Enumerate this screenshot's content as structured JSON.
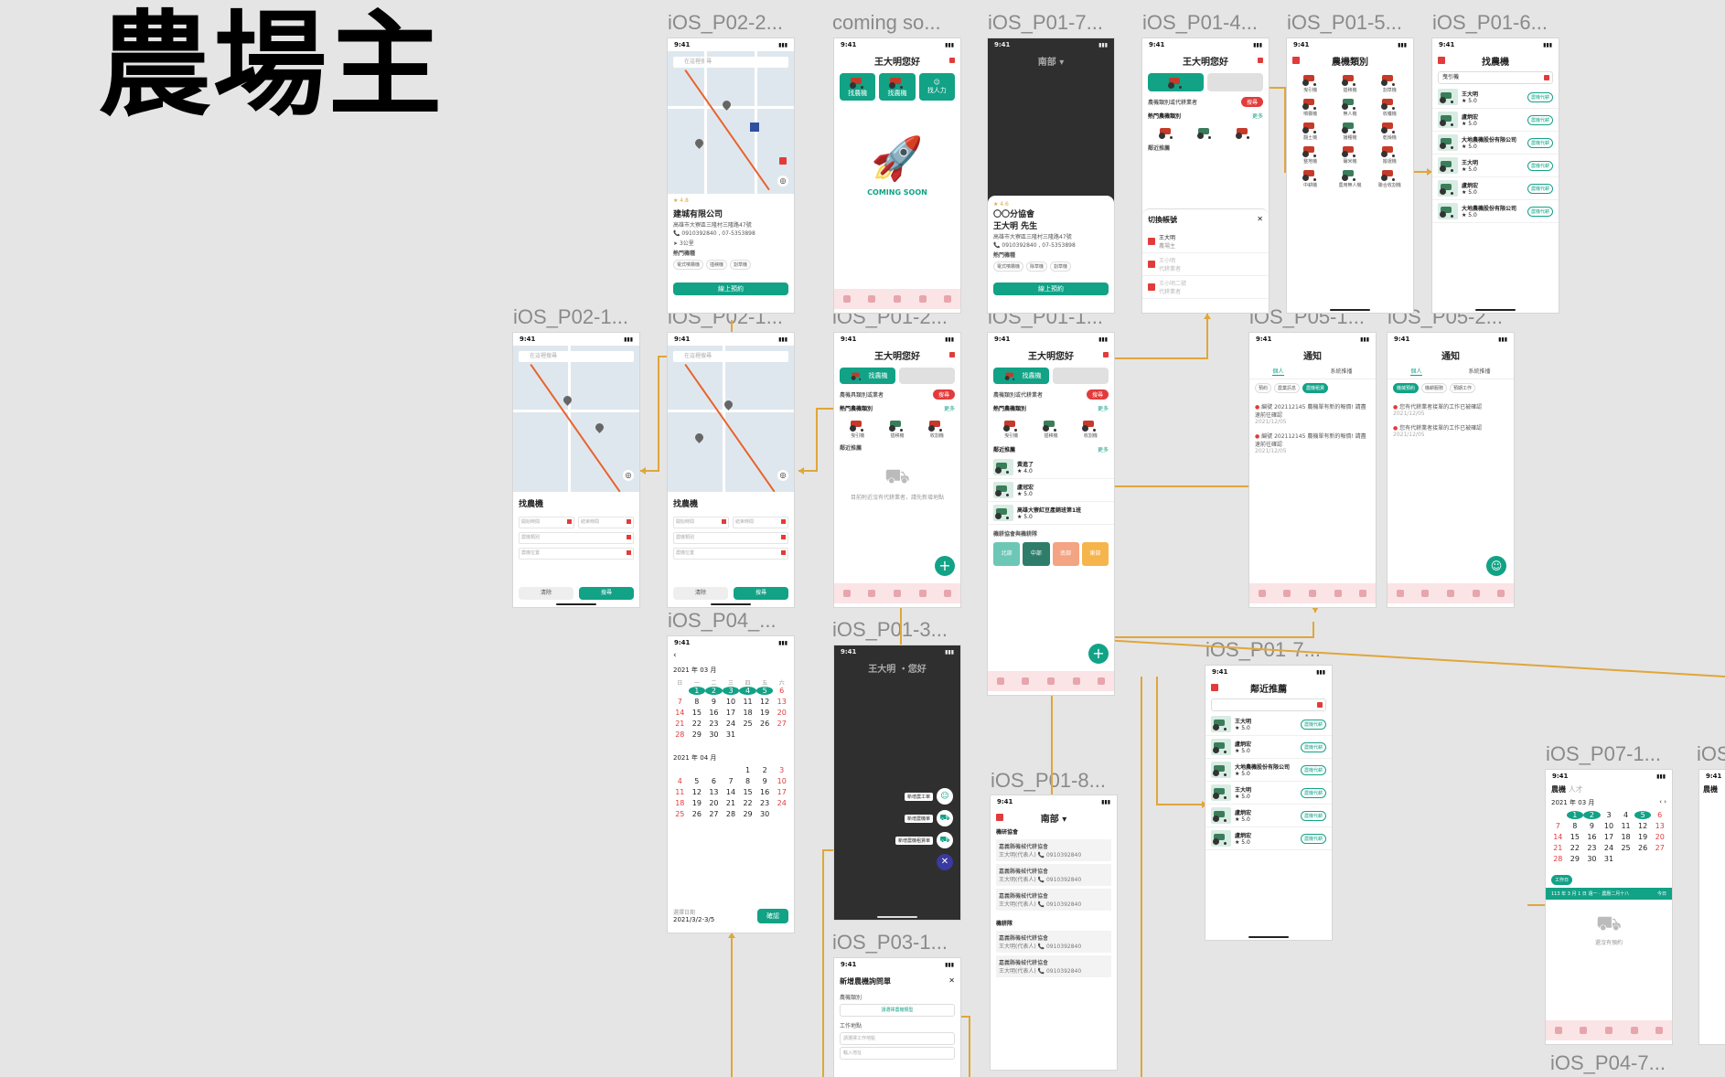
{
  "page_title": "農場主",
  "frames": {
    "p02_2": {
      "label": "iOS_P02-2...",
      "time": "9:41",
      "search_placeholder": "在這裡搜尋",
      "company": "建城有限公司",
      "rating": "4.8",
      "address": "高雄市大寮區三隆村三隆路47號",
      "phone": "0910392840 , 07-5353898",
      "distance": "3公里",
      "section": "熱門機種",
      "tags": [
        "電式噴霧機",
        "插秧機",
        "割草機"
      ],
      "cta": "線上預約"
    },
    "coming": {
      "label": "coming so...",
      "time": "9:41",
      "greeting": "王大明您好",
      "chips": [
        "找農機",
        "找農機",
        "找人力"
      ],
      "coming_text": "COMING SOON"
    },
    "p01_7a": {
      "label": "iOS_P01-7...",
      "time": "9:41",
      "region": "南部 ▾",
      "org": "〇〇分協會",
      "person": "王大明  先生",
      "rating": "4.6",
      "address": "高雄市大寮區三隆村三隆路47號",
      "phone": "0910392840 , 07-5353898",
      "section": "熱門機種",
      "tags": [
        "電式噴霧機",
        "除草機",
        "割草機"
      ],
      "cta": "線上預約"
    },
    "p01_4": {
      "label": "iOS_P01-4...",
      "time": "9:41",
      "greeting": "王大明您好",
      "search": "農機類別或代耕業者",
      "search_btn": "搜尋",
      "hot": "熱門農機類別",
      "more": "更多",
      "nearby": "鄰近推薦",
      "switch_title": "切換帳號",
      "accounts": [
        {
          "name": "王大明",
          "role": "農場主"
        },
        {
          "name": "王小明",
          "role": "代耕業者"
        },
        {
          "name": "王小明二號",
          "role": "代耕業者"
        }
      ]
    },
    "p01_5": {
      "label": "iOS_P01-5...",
      "time": "9:41",
      "title": "農機類別",
      "items": [
        "曳引機",
        "插秧機",
        "割草機",
        "噴霧機",
        "無人機",
        "收穫機",
        "翻土機",
        "播種機",
        "乾燥機",
        "整地機",
        "碾米機",
        "搬運機",
        "中耕機",
        "農用無人機",
        "聯合收割機"
      ]
    },
    "p01_6": {
      "label": "iOS_P01-6...",
      "time": "9:41",
      "title": "找農機",
      "search_value": "曳引機",
      "results": [
        {
          "name": "王大明",
          "rating": "5.0"
        },
        {
          "name": "盧炳宏",
          "rating": "5.0"
        },
        {
          "name": "大地農機股份有限公司",
          "rating": "5.0"
        },
        {
          "name": "王大明",
          "rating": "5.0"
        },
        {
          "name": "盧炳宏",
          "rating": "5.0"
        },
        {
          "name": "大地農機股份有限公司",
          "rating": "5.0"
        }
      ],
      "badge": "農機代耕"
    },
    "p02_1a": {
      "label": "iOS_P02-1...",
      "time": "9:41",
      "search_placeholder": "在這裡搜尋",
      "title": "找農機",
      "fields": [
        "開始時間",
        "結束時間",
        "農機類別",
        "農機位置"
      ],
      "reset": "清除",
      "submit": "搜尋"
    },
    "p02_1b": {
      "label": "iOS_P02-1...",
      "time": "9:41",
      "search_placeholder": "在這裡搜尋",
      "title": "找農機",
      "fields": [
        "開始時間",
        "結束時間",
        "農機類別",
        "農機位置"
      ],
      "reset": "清除",
      "submit": "搜尋"
    },
    "p01_2": {
      "label": "iOS_P01-2...",
      "time": "9:41",
      "greeting": "王大明您好",
      "tab": "找農機",
      "search": "農機具類別或業者",
      "search_btn": "搜尋",
      "hot": "熱門農機類別",
      "more": "更多",
      "hot_items": [
        "曳引機",
        "插秧機",
        "收割機"
      ],
      "nearby": "鄰近推薦",
      "empty": "目前附近沒有代耕業者，請先新增地點"
    },
    "p01_1": {
      "label": "iOS_P01-1...",
      "time": "9:41",
      "greeting": "王大明您好",
      "tab": "找農機",
      "search": "農機類別或代耕業者",
      "search_btn": "搜尋",
      "hot": "熱門農機類別",
      "more": "更多",
      "hot_items": [
        "曳引機",
        "插秧機",
        "收割機"
      ],
      "nearby": "鄰近推薦",
      "list": [
        {
          "name": "黃進了",
          "rating": "4.0"
        },
        {
          "name": "盧冠宏",
          "rating": "5.0"
        },
        {
          "name": "高雄大寮紅豆產銷班第1班",
          "rating": "5.0"
        }
      ],
      "section2": "機耕協會與機耕隊",
      "regions": [
        "北部",
        "中部",
        "南部",
        "東部"
      ]
    },
    "p05_1": {
      "label": "iOS_P05-1...",
      "time": "9:41",
      "title": "通知",
      "tabs": [
        "個人",
        "系統推播"
      ],
      "filters": [
        "預約",
        "農業訊息",
        "農機租賃"
      ],
      "items": [
        "編號 202112145 農機單有新的報價! 請盡速前往確認",
        "編號 202112145 農機單有新的報價! 請盡速前往確認"
      ],
      "date": "2021/12/05"
    },
    "p05_2": {
      "label": "iOS_P05-2...",
      "time": "9:41",
      "title": "通知",
      "tabs": [
        "個人",
        "系統推播"
      ],
      "filters": [
        "機械預約",
        "機耕服務",
        "預期工作"
      ],
      "items": [
        "您有代耕業者接單的工作已被確認",
        "您有代耕業者接單的工作已被確認"
      ],
      "date": "2021/12/05"
    },
    "p04": {
      "label": "iOS_P04_...",
      "time": "9:41",
      "month1": "2021 年 03 月",
      "month2": "2021 年 04 月",
      "weekdays": [
        "日",
        "一",
        "二",
        "三",
        "四",
        "五",
        "六"
      ],
      "range_label": "選擇日期",
      "range": "2021/3/2-3/5",
      "confirm": "確認"
    },
    "p01_3": {
      "label": "iOS_P01-3...",
      "time": "9:41",
      "greeting": "王大明 ・您好",
      "menu": [
        "新增農工單",
        "新增農機單",
        "新增農機租賃單"
      ]
    },
    "p01_7b": {
      "label": "iOS_P01-7...",
      "time": "9:41",
      "title": "鄰近推薦",
      "results": [
        {
          "name": "王大明"
        },
        {
          "name": "盧炳宏"
        },
        {
          "name": "大地農機股份有限公司"
        },
        {
          "name": "王大明"
        },
        {
          "name": "盧炳宏"
        },
        {
          "name": "盧炳宏"
        }
      ],
      "rating": "5.0",
      "badge": "農機代耕"
    },
    "p01_8": {
      "label": "iOS_P01-8...",
      "time": "9:41",
      "region": "南部 ▾",
      "group1": "機研協會",
      "group2": "機耕隊",
      "org": "嘉義縣機械代耕協會",
      "rep": "王大明(代表人)",
      "phone": "0910392840"
    },
    "p03_1": {
      "label": "iOS_P03-1...",
      "time": "9:41",
      "title": "新增農機詢問單",
      "type_label": "農機類別",
      "type_placeholder": "請選擇農機類型",
      "field_label": "工作地點",
      "field_placeholder": "請選擇工作地點",
      "hint": "輸入地址"
    },
    "p07_1": {
      "label": "iOS_P07-1...",
      "time": "9:41",
      "tabs": [
        "農機",
        "人才"
      ],
      "month": "2021 年 03 月",
      "tag": "工作日",
      "banner": "113 年 3 月 1 日 週一 · 農曆二月十八",
      "today": "今日",
      "empty": "還沒有預約"
    },
    "p07_2": {
      "label": "iOS_",
      "time": "9:41",
      "tab": "農機"
    },
    "p04_7": {
      "label": "iOS_P04-7..."
    }
  },
  "colors": {
    "accent": "#12a286",
    "red": "#e23b3b",
    "connector": "#e0a63a",
    "bg": "#e5e5e5"
  }
}
